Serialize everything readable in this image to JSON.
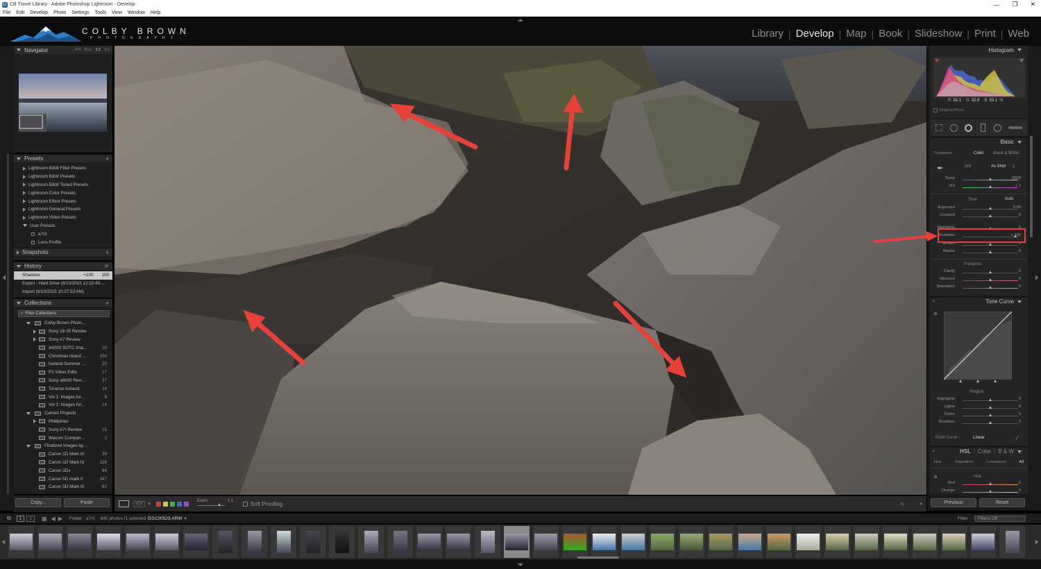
{
  "window": {
    "title": "CB Travel Library - Adobe Photoshop Lightroom - Develop"
  },
  "menu": [
    "File",
    "Edit",
    "Develop",
    "Photo",
    "Settings",
    "Tools",
    "View",
    "Window",
    "Help"
  ],
  "brand": {
    "name": "COLBY BROWN",
    "sub": "PHOTOGRAPHY"
  },
  "modules": [
    "Library",
    "Develop",
    "Map",
    "Book",
    "Slideshow",
    "Print",
    "Web"
  ],
  "navigator": {
    "title": "Navigator",
    "zoom_options": [
      "FIT",
      "FILL",
      "1:1",
      "2:1"
    ]
  },
  "presets": {
    "title": "Presets",
    "items": [
      "Lightroom B&W Filter Presets",
      "Lightroom B&W Presets",
      "Lightroom B&W Toned Presets",
      "Lightroom Color Presets",
      "Lightroom Effect Presets",
      "Lightroom General Presets",
      "Lightroom Video Presets",
      "User Presets"
    ],
    "user_children": [
      "a7rII",
      "Lens Profile"
    ]
  },
  "snapshots": {
    "title": "Snapshots"
  },
  "history": {
    "title": "History",
    "items": [
      {
        "label": "Shadows",
        "from": "+100",
        "to": "100"
      },
      {
        "label": "Export - Hard Drive (8/13/2015 12:22:49 ..."
      },
      {
        "label": "Import (8/10/2015 10:27:53 AM)"
      }
    ]
  },
  "collections": {
    "title": "Collections",
    "filter_label": "Filter Collections",
    "items": [
      {
        "name": "Colby Brown Photo...",
        "level": 1,
        "count": ""
      },
      {
        "name": "Sony 16-35 Review",
        "level": 2,
        "count": ""
      },
      {
        "name": "Sony A7 Review",
        "level": 2,
        "count": ""
      },
      {
        "name": "A6000 SOTC Ima...",
        "level": 2,
        "count": "10"
      },
      {
        "name": "Christmas Island ...",
        "level": 2,
        "count": "100"
      },
      {
        "name": "Iceland Summer ...",
        "level": 2,
        "count": "23"
      },
      {
        "name": "P1 Video Edits",
        "level": 2,
        "count": "17"
      },
      {
        "name": "Sony a6000 Revi...",
        "level": 2,
        "count": "37"
      },
      {
        "name": "Terance Iceland",
        "level": 2,
        "count": "16"
      },
      {
        "name": "Vol 1: Images for...",
        "level": 2,
        "count": "9"
      },
      {
        "name": "Vol 2: Images for...",
        "level": 2,
        "count": "14"
      },
      {
        "name": "Current Projects",
        "level": 1,
        "count": ""
      },
      {
        "name": "Phillipines",
        "level": 2,
        "count": ""
      },
      {
        "name": "Sony A7r Review",
        "level": 2,
        "count": "15"
      },
      {
        "name": "Wacom Compan...",
        "level": 2,
        "count": "3"
      },
      {
        "name": "Finalized Images by ...",
        "level": 1,
        "count": ""
      },
      {
        "name": "Canon 1D Mark III",
        "level": 2,
        "count": "38"
      },
      {
        "name": "Canon 1D Mark IV",
        "level": 2,
        "count": "228"
      },
      {
        "name": "Canon 1Dx",
        "level": 2,
        "count": "84"
      },
      {
        "name": "Canon 5D mark II",
        "level": 2,
        "count": "187"
      },
      {
        "name": "Canon 5D Mark III",
        "level": 2,
        "count": "62"
      }
    ]
  },
  "left_buttons": {
    "copy": "Copy...",
    "paste": "Paste"
  },
  "histogram": {
    "title": "Histogram",
    "r_label": "R",
    "r": "32.1",
    "g_label": "G",
    "g": "32.6",
    "b_label": "B",
    "b": "33.1",
    "unit": "%",
    "original_photo": "Original Photo"
  },
  "basic": {
    "title": "Basic",
    "treatment_label": "Treatment :",
    "treatment_color": "Color",
    "treatment_bw": "Black & White",
    "wb_label": "WB :",
    "wb_value": "As Shot",
    "temp": {
      "label": "Temp",
      "value": "5000",
      "pos": 0.5
    },
    "tint": {
      "label": "Tint",
      "value": "+ 1",
      "pos": 0.5
    },
    "tone_label": "Tone",
    "auto_label": "Auto",
    "sliders": [
      {
        "label": "Exposure",
        "value": "0.00",
        "pos": 0.5
      },
      {
        "label": "Contrast",
        "value": "0",
        "pos": 0.5
      },
      {
        "label": "Highlights",
        "value": "0",
        "pos": 0.5
      },
      {
        "label": "Shadows",
        "value": "+ 100",
        "pos": 0.95
      },
      {
        "label": "Whites",
        "value": "0",
        "pos": 0.5
      },
      {
        "label": "Blacks",
        "value": "0",
        "pos": 0.5
      }
    ],
    "presence_label": "Presence",
    "presence": [
      {
        "label": "Clarity",
        "value": "0",
        "pos": 0.5
      },
      {
        "label": "Vibrance",
        "value": "0",
        "pos": 0.5
      },
      {
        "label": "Saturation",
        "value": "0",
        "pos": 0.5
      }
    ]
  },
  "tone_curve": {
    "title": "Tone Curve",
    "region_label": "Region",
    "regions": [
      {
        "label": "Highlights",
        "value": "0",
        "pos": 0.5
      },
      {
        "label": "Lights",
        "value": "0",
        "pos": 0.5
      },
      {
        "label": "Darks",
        "value": "0",
        "pos": 0.5
      },
      {
        "label": "Shadows",
        "value": "0",
        "pos": 0.5
      }
    ],
    "point_curve_label": "Point Curve :",
    "point_curve_value": "Linear"
  },
  "hsl": {
    "title_hsl": "HSL",
    "title_color": "Color",
    "title_bw": "B & W",
    "tabs": [
      "Hue",
      "Saturation",
      "Luminance",
      "All"
    ],
    "hue_label": "Hue",
    "rows": [
      {
        "label": "Red",
        "value": "0",
        "pos": 0.5
      },
      {
        "label": "Orange",
        "value": "0",
        "pos": 0.5
      }
    ]
  },
  "right_buttons": {
    "previous": "Previous",
    "reset": "Reset"
  },
  "toolbar": {
    "zoom_label": "Zoom",
    "zoom_value": "1:1",
    "soft_proofing": "Soft Proofing",
    "color_labels": [
      "#d23a3a",
      "#d8c63a",
      "#3ab24a",
      "#3a6ad8",
      "#9a4ad8"
    ]
  },
  "filmstrip": {
    "page1": "1",
    "page2": "2",
    "folder_label": "Folder : a7rII",
    "count_label": "840 photos /1 selected /",
    "file": "DSC00523.ARW",
    "filter_label": "Filter :",
    "filter_value": "Filters Off",
    "thumb_count": 35,
    "selected_index": 17
  },
  "annotation_color": "#e8413a",
  "accent": {
    "panel_bg": "#252525",
    "highlight_box": "#e8413a"
  }
}
